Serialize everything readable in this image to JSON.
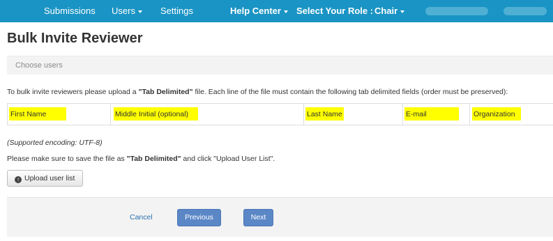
{
  "nav": {
    "submissions": "Submissions",
    "users": "Users",
    "settings": "Settings",
    "help_center": "Help Center",
    "select_role": "Select Your Role :",
    "role": "Chair"
  },
  "page": {
    "title": "Bulk Invite Reviewer",
    "step": "Choose users"
  },
  "instructions": {
    "pre": "To bulk invite reviewers please upload a ",
    "format": "\"Tab Delimited\"",
    "post": " file. Each line of the file must contain the following tab delimited fields (order must be preserved):"
  },
  "fields": [
    "First Name",
    "Middle Initial (optional)",
    "Last Name",
    "E-mail",
    "Organization"
  ],
  "encoding_note": "(Supported encoding: UTF-8)",
  "save_note": {
    "pre": "Please make sure to save the file as ",
    "format": "\"Tab Delimited\"",
    "post": " and click \"Upload User List\"."
  },
  "buttons": {
    "upload": "Upload user list",
    "cancel": "Cancel",
    "previous": "Previous",
    "next": "Next"
  },
  "colors": {
    "navbar": "#1a94c4",
    "highlight": "#ffff00",
    "primary_button": "#5b87c6"
  },
  "icons": {
    "upload": "upload-circle-icon",
    "dropdown": "caret-down-icon"
  }
}
